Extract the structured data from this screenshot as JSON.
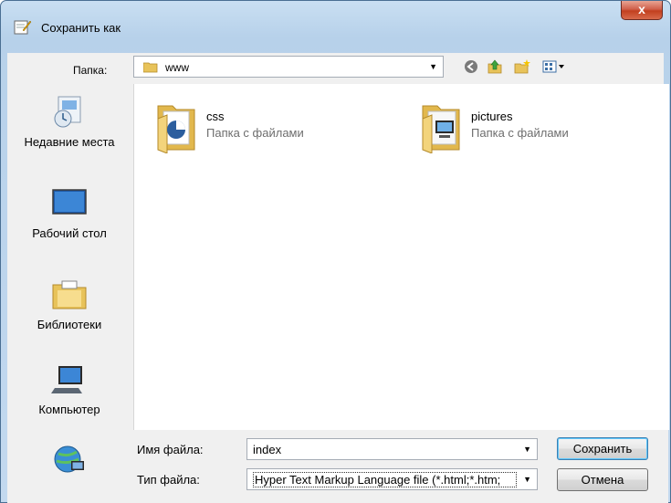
{
  "window": {
    "title": "Сохранить как",
    "close_label": "x"
  },
  "location": {
    "label": "Папка:",
    "value": "www"
  },
  "toolbar": {
    "back_icon": "back-icon",
    "up_icon": "up-folder-icon",
    "new_folder_icon": "new-folder-icon",
    "views_icon": "views-menu-icon"
  },
  "places": [
    {
      "label": "Недавние места",
      "icon": "recent-places-icon"
    },
    {
      "label": "Рабочий стол",
      "icon": "desktop-icon"
    },
    {
      "label": "Библиотеки",
      "icon": "libraries-icon"
    },
    {
      "label": "Компьютер",
      "icon": "computer-icon"
    },
    {
      "label": "",
      "icon": "network-icon"
    }
  ],
  "files": [
    {
      "name": "css",
      "type": "Папка с файлами",
      "icon": "folder-icon"
    },
    {
      "name": "pictures",
      "type": "Папка с файлами",
      "icon": "folder-pictures-icon"
    }
  ],
  "filename": {
    "label": "Имя файла:",
    "value": "index"
  },
  "filetype": {
    "label": "Тип файла:",
    "value": "Hyper Text Markup Language file (*.html;*.htm;"
  },
  "buttons": {
    "save": "Сохранить",
    "cancel": "Отмена"
  }
}
